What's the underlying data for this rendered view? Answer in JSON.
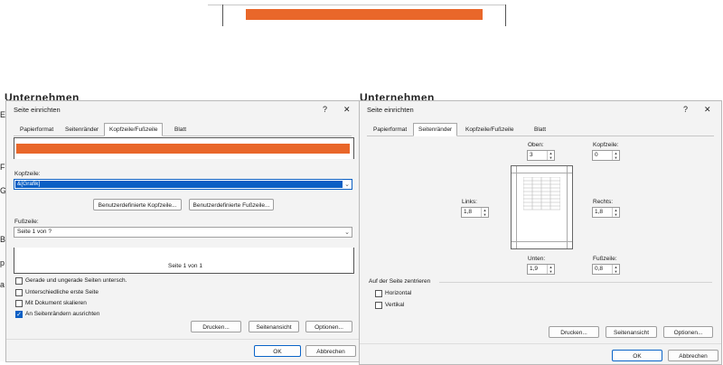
{
  "colors": {
    "accent_orange": "#E9672A",
    "selection_blue": "#0A5FC4",
    "primary_border": "#0A64C8"
  },
  "icons": [
    "help-icon",
    "close-icon",
    "chevron-down-icon",
    "checkmark-icon",
    "spin-up-icon",
    "spin-down-icon"
  ],
  "background": {
    "left_peek_text": "Unternehmen",
    "right_peek_text": "Unternehmen",
    "left_edge_letters": [
      "E",
      "F",
      "G",
      "B",
      "p",
      "a"
    ]
  },
  "dialog_left": {
    "title": "Seite einrichten",
    "help": "?",
    "close": "✕",
    "tabs": [
      "Papierformat",
      "Seitenränder",
      "Kopfzeile/Fußzeile",
      "Blatt"
    ],
    "active_tab": "Kopfzeile/Fußzeile",
    "header_label": "Kopfzeile:",
    "header_value": "&[Grafik]",
    "custom_header_button": "Benutzerdefinierte Kopfzeile...",
    "custom_footer_button": "Benutzerdefinierte Fußzeile...",
    "footer_label": "Fußzeile:",
    "footer_value": "Seite 1 von ?",
    "footer_preview": "Seite 1 von 1",
    "checkboxes": [
      {
        "label": "Gerade und ungerade Seiten untersch.",
        "checked": false
      },
      {
        "label": "Unterschiedliche erste Seite",
        "checked": false
      },
      {
        "label": "Mit Dokument skalieren",
        "checked": false
      },
      {
        "label": "An Seitenrändern ausrichten",
        "checked": true
      }
    ],
    "print_button": "Drucken...",
    "preview_button": "Seitenansicht",
    "options_button": "Optionen...",
    "ok_button": "OK",
    "cancel_button": "Abbrechen"
  },
  "dialog_right": {
    "title": "Seite einrichten",
    "help": "?",
    "close": "✕",
    "tabs": [
      "Papierformat",
      "Seitenränder",
      "Kopfzeile/Fußzeile",
      "Blatt"
    ],
    "active_tab": "Seitenränder",
    "top_label": "Oben:",
    "top_value": "3",
    "header_label": "Kopfzeile:",
    "header_value": "0",
    "left_label": "Links:",
    "left_value": "1,8",
    "right_label": "Rechts:",
    "right_value": "1,8",
    "bottom_label": "Unten:",
    "bottom_value": "1,9",
    "footer_label": "Fußzeile:",
    "footer_value": "0,8",
    "center_section": "Auf der Seite zentrieren",
    "horizontal": "Horizontal",
    "vertical": "Vertikal",
    "print_button": "Drucken...",
    "preview_button": "Seitenansicht",
    "options_button": "Optionen...",
    "ok_button": "OK",
    "cancel_button": "Abbrechen"
  }
}
